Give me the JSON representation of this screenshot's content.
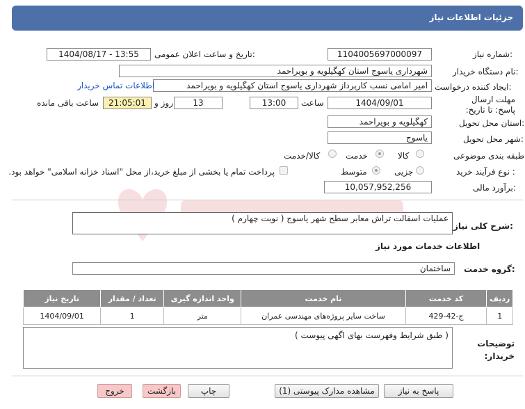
{
  "header": {
    "title": "جزئیات اطلاعات نیاز"
  },
  "fields": {
    "need_number_label": "شماره نیاز:",
    "need_number": "1104005697000097",
    "announce_label": "تاریخ و ساعت اعلان عمومی:",
    "announce_value": "1404/08/17 - 13:55",
    "buyer_org_label": "نام دستگاه خریدار:",
    "buyer_org": "شهرداری یاسوج استان کهگیلویه و بویراحمد",
    "creator_label": "ایجاد کننده درخواست:",
    "creator": "امیر امامی نسب کارپرداز شهرداری یاسوج استان کهگیلویه و بویراحمد",
    "contact_link": "اطلاعات تماس خریدار",
    "deadline_label": "مهلت ارسال پاسخ: تا تاریخ:",
    "deadline_date": "1404/09/01",
    "time_label": "ساعت",
    "deadline_time": "13:00",
    "days": "13",
    "days_label": "روز و",
    "remaining": "21:05:01",
    "remaining_label": "ساعت باقی مانده",
    "province_label": "استان محل تحویل:",
    "province": "کهگیلویه و بویراحمد",
    "city_label": "شهر محل تحویل:",
    "city": "یاسوج",
    "category_label": "طبقه بندی موضوعی:",
    "category_options": [
      "کالا",
      "خدمت",
      "کالا/خدمت"
    ],
    "purchase_type_label": "نوع فرآیند خرید :",
    "purchase_options": [
      "جزیی",
      "متوسط"
    ],
    "payment_note": "پرداخت تمام یا بخشی از مبلغ خرید،از محل \"اسناد خزانه اسلامی\" خواهد بود.",
    "estimate_label": "برآورد مالی:",
    "estimate": "10,057,952,256"
  },
  "summary": {
    "label": "شرح کلی نیاز:",
    "text": "عملیات اسفالت تراش معابر سطح شهر یاسوج ( نوبت چهارم )"
  },
  "services": {
    "section_title": "اطلاعات خدمات مورد نیاز",
    "group_label": "گروه خدمت:",
    "group_value": "ساختمان",
    "columns": [
      "ردیف",
      "کد خدمت",
      "نام خدمت",
      "واحد اندازه گیری",
      "تعداد / مقدار",
      "تاریخ نیاز"
    ],
    "rows": [
      [
        "1",
        "ج-42-429",
        "ساخت سایر پروژه‌های مهندسی عمران",
        "متر",
        "1",
        "1404/09/01"
      ]
    ]
  },
  "buyer_notes": {
    "label": "توضیحات خریدار:",
    "text": "( طبق شرایط وفهرست بهای اگهی پیوست )"
  },
  "buttons": {
    "reply": "پاسخ به نیاز",
    "attachments": "مشاهده مدارک پیوستی (1)",
    "print": "چاپ",
    "back": "بازگشت",
    "exit": "خروج"
  },
  "colors": {
    "header_bg": "#4e70a8",
    "highlight": "#fbf0b0",
    "table_header": "#8d8d8d",
    "danger_btn": "#f8c8c8"
  }
}
